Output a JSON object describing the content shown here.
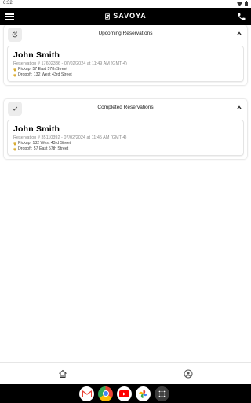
{
  "status_bar": {
    "time": "6:32"
  },
  "app_bar": {
    "brand": "SAVOYA",
    "menu_icon": "hamburger-menu-icon",
    "call_icon": "phone-icon"
  },
  "upcoming": {
    "title": "Upcoming Reservations",
    "icon": "clock-refresh-icon",
    "reservations": [
      {
        "name": "John Smith",
        "reservation": "Reservation # 17602336 - 07/02/2024 at 11:49 AM (GMT-4)",
        "pickup": "Pickup: 57 East 57th Street",
        "dropoff": "Dropoff: 132 West 43rd Street"
      }
    ]
  },
  "completed": {
    "title": "Completed Reservations",
    "icon": "checkmark-icon",
    "reservations": [
      {
        "name": "John Smith",
        "reservation": "Reservation # 35110392 - 07/02/2024 at 11:45 AM (GMT-4)",
        "pickup": "Pickup: 132 West 43rd Street",
        "dropoff": "Dropoff: 57 East 57th Street"
      }
    ]
  },
  "bottom_nav": {
    "items": [
      "home-icon",
      "account-icon"
    ]
  },
  "dock": {
    "apps": [
      "gmail-icon",
      "chrome-icon",
      "youtube-icon",
      "photos-icon",
      "app-drawer-icon"
    ]
  },
  "colors": {
    "app_bar": "#000000",
    "pin": "#d4a017",
    "muted_text": "#8a8a8a"
  }
}
